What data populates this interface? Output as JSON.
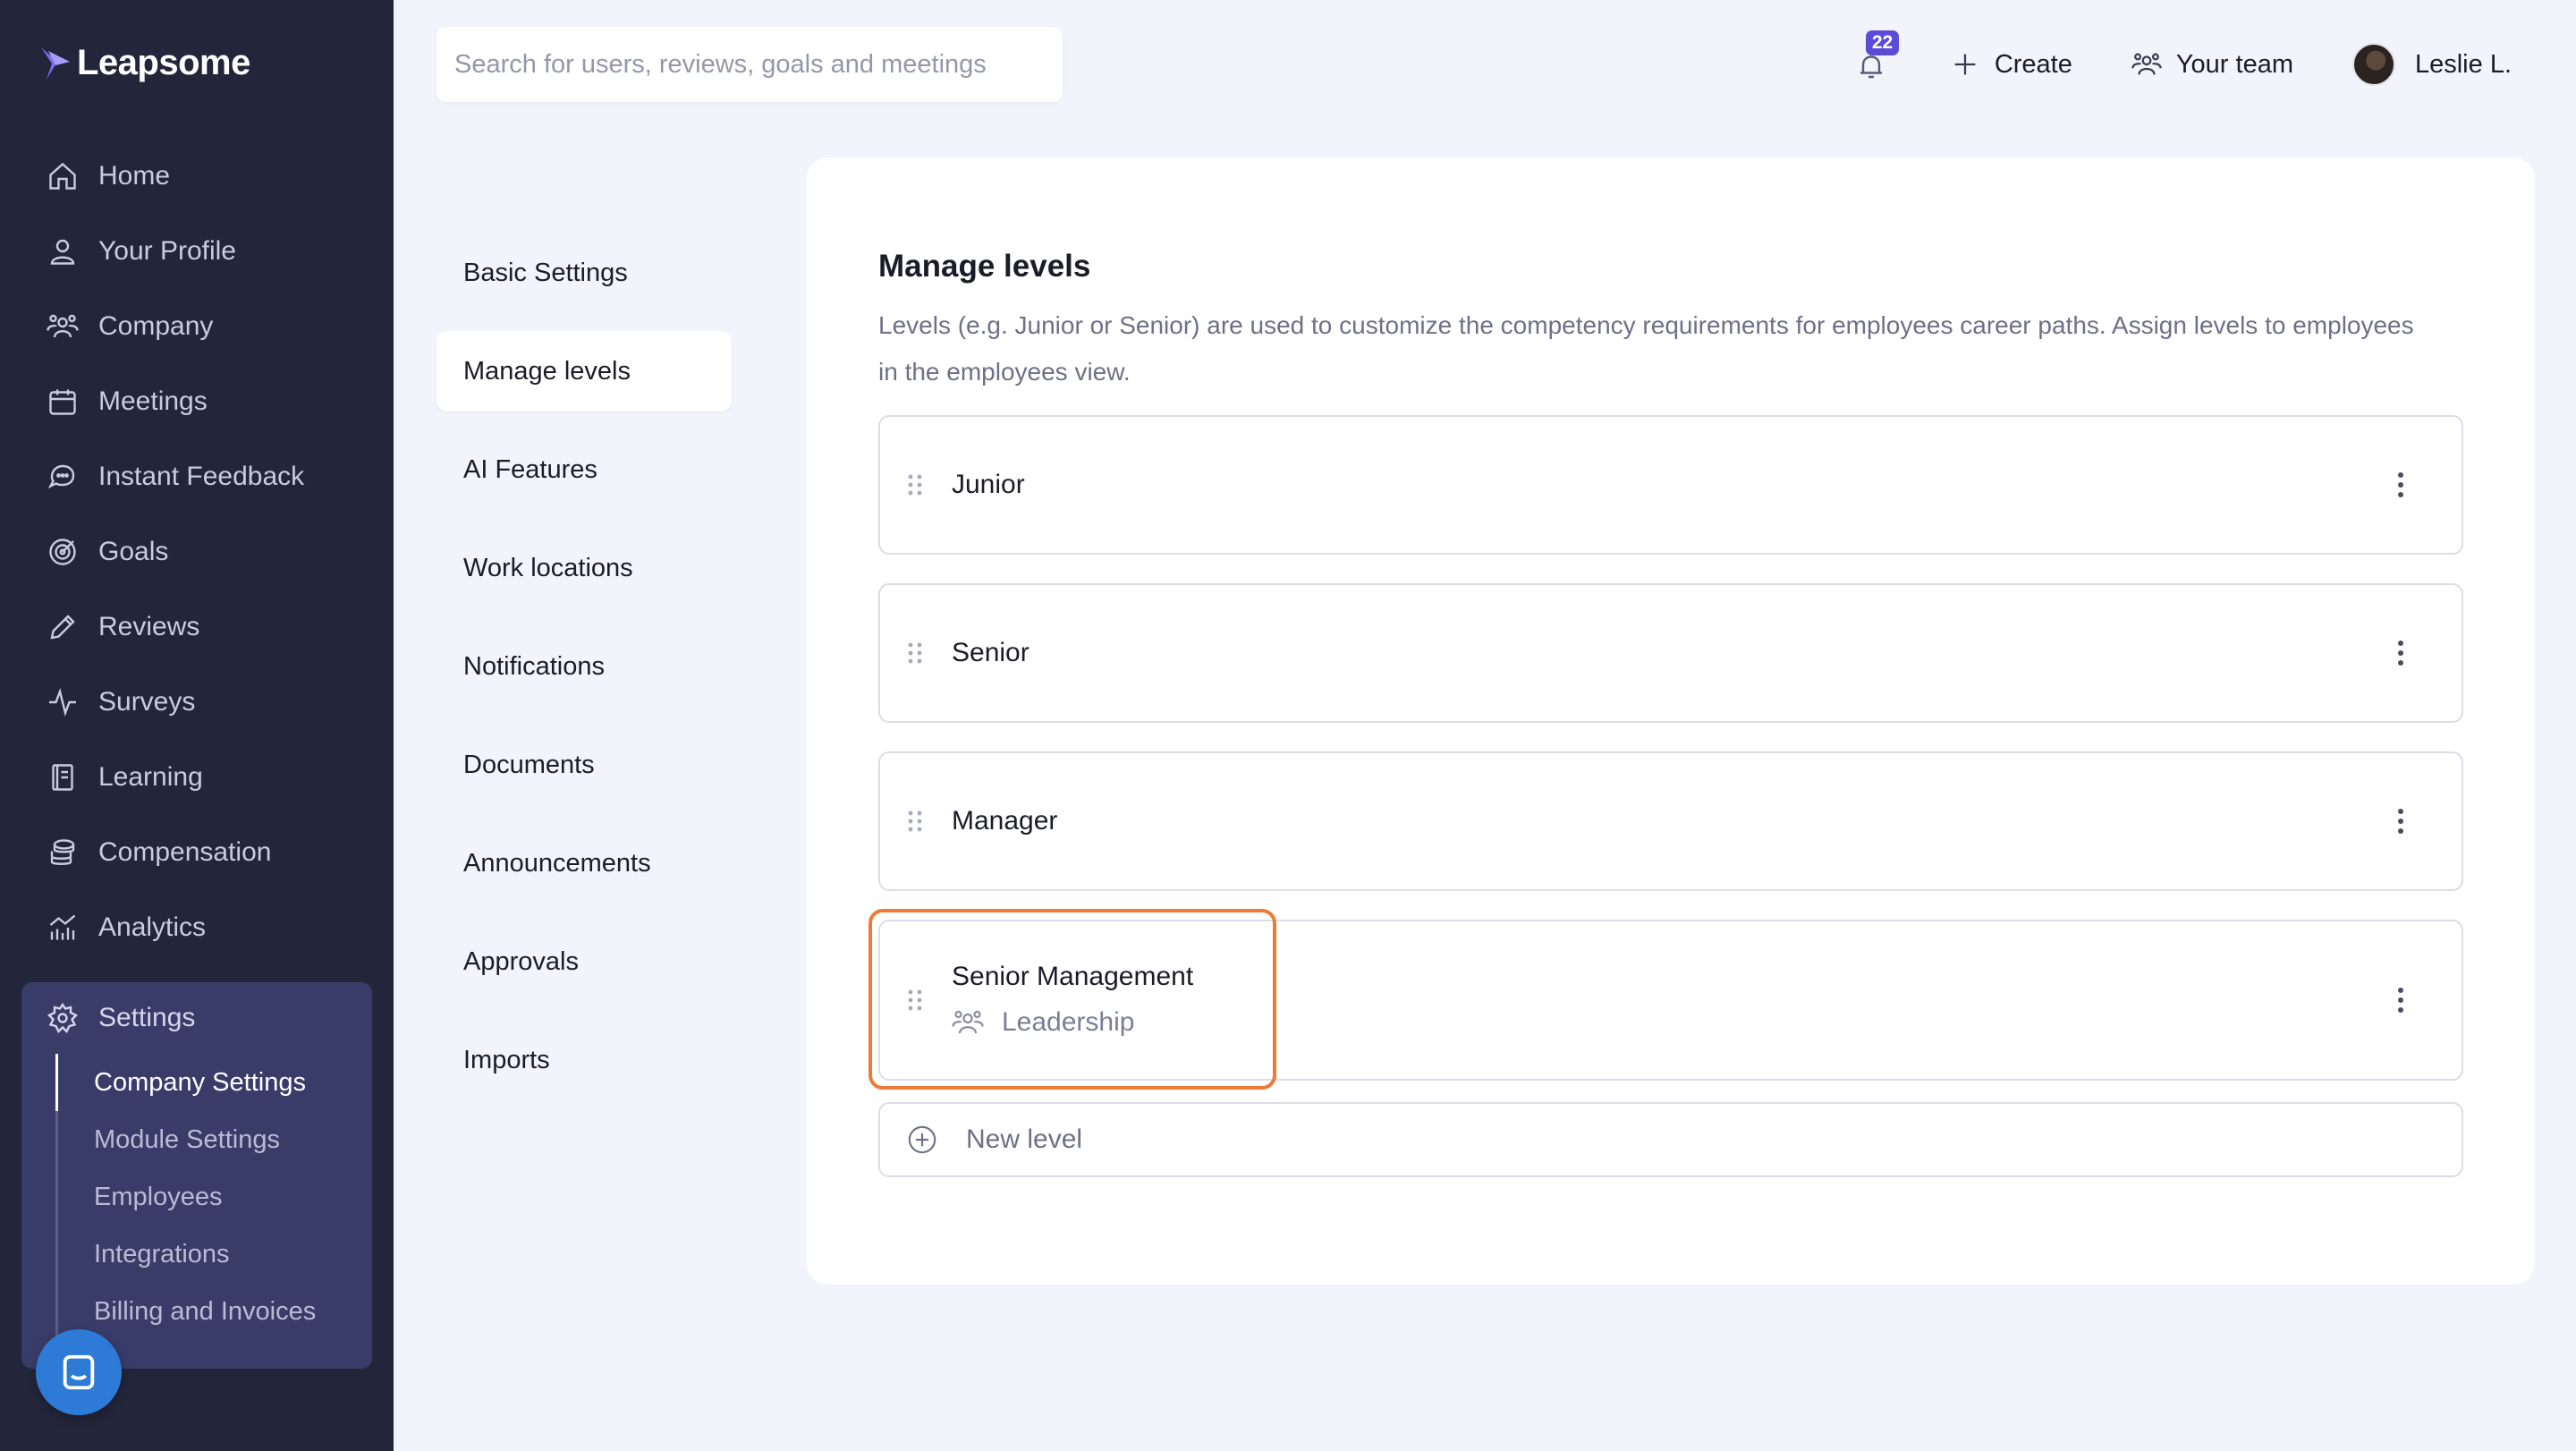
{
  "brand": {
    "name": "Leapsome"
  },
  "sidebar": {
    "items": [
      {
        "label": "Home",
        "icon": "home-icon"
      },
      {
        "label": "Your Profile",
        "icon": "user-icon"
      },
      {
        "label": "Company",
        "icon": "people-icon"
      },
      {
        "label": "Meetings",
        "icon": "calendar-icon"
      },
      {
        "label": "Instant Feedback",
        "icon": "chat-icon"
      },
      {
        "label": "Goals",
        "icon": "target-icon"
      },
      {
        "label": "Reviews",
        "icon": "pencil-icon"
      },
      {
        "label": "Surveys",
        "icon": "pulse-icon"
      },
      {
        "label": "Learning",
        "icon": "book-icon"
      },
      {
        "label": "Compensation",
        "icon": "coins-icon"
      },
      {
        "label": "Analytics",
        "icon": "chart-icon"
      }
    ],
    "settings": {
      "label": "Settings",
      "icon": "gear-icon",
      "sub_items": [
        {
          "label": "Company Settings",
          "active": true
        },
        {
          "label": "Module Settings",
          "active": false
        },
        {
          "label": "Employees",
          "active": false
        },
        {
          "label": "Integrations",
          "active": false
        },
        {
          "label": "Billing and Invoices",
          "active": false
        }
      ]
    }
  },
  "topbar": {
    "search_placeholder": "Search for users, reviews, goals and meetings",
    "notifications_count": "22",
    "create_label": "Create",
    "team_label": "Your team",
    "user_name": "Leslie L."
  },
  "settings_menu": {
    "items": [
      {
        "label": "Basic Settings",
        "active": false
      },
      {
        "label": "Manage levels",
        "active": true
      },
      {
        "label": "AI Features",
        "active": false
      },
      {
        "label": "Work locations",
        "active": false
      },
      {
        "label": "Notifications",
        "active": false
      },
      {
        "label": "Documents",
        "active": false
      },
      {
        "label": "Announcements",
        "active": false
      },
      {
        "label": "Approvals",
        "active": false
      },
      {
        "label": "Imports",
        "active": false
      }
    ]
  },
  "main": {
    "title": "Manage levels",
    "description": "Levels (e.g. Junior or Senior) are used to customize the competency requirements for employees career paths. Assign levels to employees in the employees view.",
    "levels": [
      {
        "name": "Junior",
        "group": ""
      },
      {
        "name": "Senior",
        "group": ""
      },
      {
        "name": "Manager",
        "group": ""
      },
      {
        "name": "Senior Management",
        "group": "Leadership"
      }
    ],
    "new_level_label": "New level"
  },
  "colors": {
    "sidebar_bg": "#23253a",
    "settings_bg": "#393c69",
    "page_bg": "#f3f3fb",
    "badge": "#5b4bd6",
    "highlight": "#ec7b38",
    "chat": "#2d7bd6"
  }
}
